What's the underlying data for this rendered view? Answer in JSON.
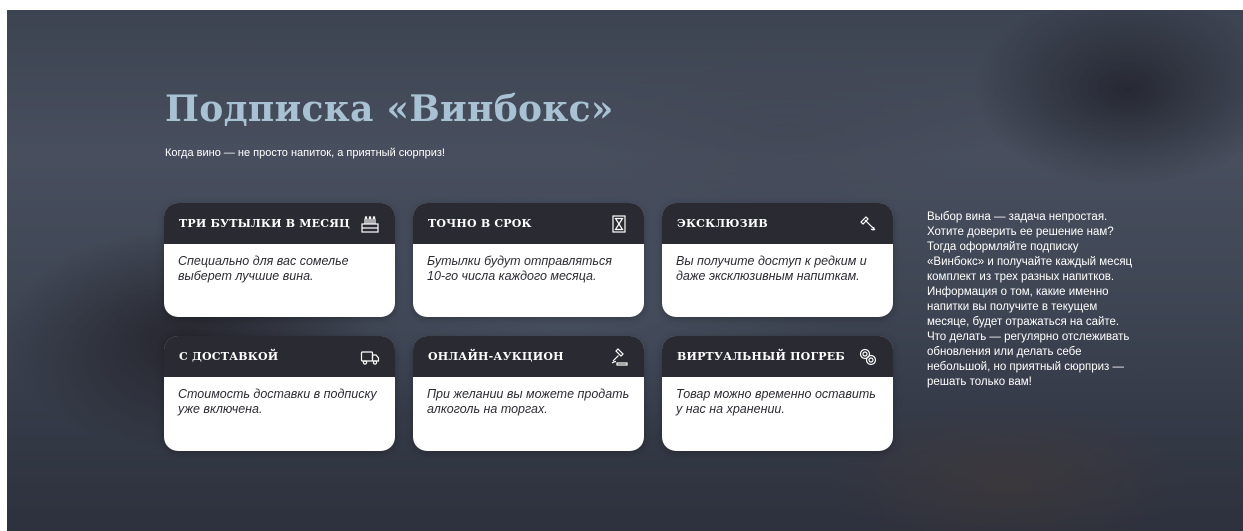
{
  "hero": {
    "title": "Подписка «Винбокс»",
    "subtitle": "Когда вино — не просто напиток, а приятный сюрприз!"
  },
  "cards": [
    {
      "title": "Три бутылки в месяц",
      "icon": "wine-crate-icon",
      "text": "Специально для вас сомелье выберет лучшие вина."
    },
    {
      "title": "Точно в срок",
      "icon": "hourglass-icon",
      "text": "Бутылки будут отправляться 10-го числа каждого месяца."
    },
    {
      "title": "Эксклюзив",
      "icon": "corkscrew-icon",
      "text": "Вы получите доступ к редким и даже эксклюзивным напиткам."
    },
    {
      "title": "С доставкой",
      "icon": "delivery-truck-icon",
      "text": "Стоимость доставки в подписку уже включена."
    },
    {
      "title": "Онлайн-аукцион",
      "icon": "auction-gavel-icon",
      "text": "При желании вы можете продать алкоголь на торгах."
    },
    {
      "title": "Виртуальный погреб",
      "icon": "wine-barrels-icon",
      "text": "Товар можно временно оставить у нас на хранении."
    }
  ],
  "side": {
    "text": "Выбор вина — задача непростая. Хотите доверить ее решение нам? Тогда оформляйте подписку «Винбокс» и получайте каждый месяц комплект из трех разных напитков. Информация о том, какие именно напитки вы получите в текущем месяце, будет отражаться на сайте. Что делать — регулярно отслеживать обновления или делать себе небольшой, но приятный сюрприз — решать только вам!"
  },
  "colors": {
    "title": "#a9c2d3",
    "card_header": "#2a2a33",
    "card_body": "#ffffff",
    "text_dark": "#2b2b33"
  }
}
